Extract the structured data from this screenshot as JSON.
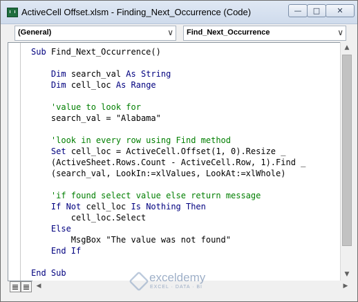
{
  "window": {
    "title": "ActiveCell Offset.xlsm - Finding_Next_Occurrence (Code)",
    "minimize_glyph": "—",
    "maximize_glyph": "□",
    "close_glyph": "✕"
  },
  "object_dropdown": {
    "value": "(General)",
    "arrow": "∨"
  },
  "procedure_dropdown": {
    "value": "Find_Next_Occurrence",
    "arrow": "∨"
  },
  "code": {
    "lines": [
      {
        "kw": "Sub ",
        "text": "Find_Next_Occurrence()"
      },
      {
        "kw": "",
        "text": ""
      },
      {
        "indent": "    ",
        "kw": "Dim ",
        "text": "search_val ",
        "kw2": "As String"
      },
      {
        "indent": "    ",
        "kw": "Dim ",
        "text": "cell_loc ",
        "kw2": "As Range"
      },
      {
        "kw": "",
        "text": ""
      },
      {
        "indent": "    ",
        "comment": "'value to look for"
      },
      {
        "indent": "    ",
        "text": "search_val = \"Alabama\""
      },
      {
        "kw": "",
        "text": ""
      },
      {
        "indent": "    ",
        "comment": "'look in every row using Find method"
      },
      {
        "indent": "    ",
        "kw": "Set ",
        "text": "cell_loc = ActiveCell.Offset(1, 0).Resize _"
      },
      {
        "indent": "    ",
        "text": "(ActiveSheet.Rows.Count - ActiveCell.Row, 1).Find _"
      },
      {
        "indent": "    ",
        "text": "(search_val, LookIn:=xlValues, LookAt:=xlWhole)"
      },
      {
        "kw": "",
        "text": ""
      },
      {
        "indent": "    ",
        "comment": "'if found select value else return message"
      },
      {
        "indent": "    ",
        "kw": "If Not ",
        "text": "cell_loc ",
        "kw2": "Is Nothing Then"
      },
      {
        "indent": "        ",
        "text": "cell_loc.Select"
      },
      {
        "indent": "    ",
        "kw": "Else"
      },
      {
        "indent": "        ",
        "text": "MsgBox \"The value was not found\""
      },
      {
        "indent": "    ",
        "kw": "End If"
      },
      {
        "kw": "",
        "text": ""
      },
      {
        "kw": "End Sub"
      }
    ]
  },
  "scrollbar": {
    "up": "▲",
    "down": "▼",
    "left": "◀",
    "right": "▶"
  },
  "watermark": {
    "name": "exceldemy",
    "tagline": "EXCEL · DATA · BI"
  },
  "colors": {
    "keyword": "#00007f",
    "text": "#000000",
    "comment": "#007f00"
  }
}
